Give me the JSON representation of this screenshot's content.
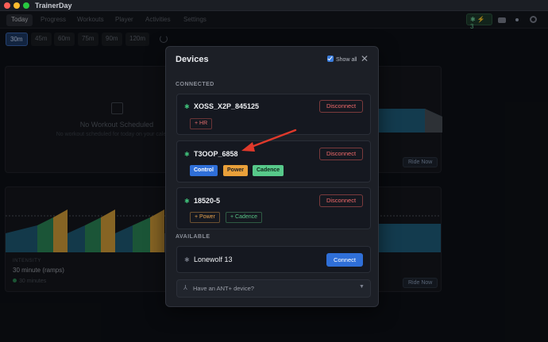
{
  "app": {
    "title": "TrainerDay"
  },
  "nav": {
    "tabs": [
      {
        "label": "Today",
        "active": true
      },
      {
        "label": "Progress"
      },
      {
        "label": "Workouts"
      },
      {
        "label": "Player"
      },
      {
        "label": "Activities"
      },
      {
        "label": "Settings"
      }
    ],
    "bluetooth_chip": "✱ ⚡ 3"
  },
  "durations": [
    {
      "label": "30m",
      "active": true
    },
    {
      "label": "45m"
    },
    {
      "label": "60m"
    },
    {
      "label": "75m"
    },
    {
      "label": "90m"
    },
    {
      "label": "120m"
    }
  ],
  "background": {
    "empty_title": "No Workout Scheduled",
    "empty_sub": "No workout scheduled for today on your calendar",
    "ride_now": "Ride Now",
    "intensity_label": "INTENSITY",
    "workout_name": "30 minute (ramps)",
    "workout_time": "30 minutes"
  },
  "modal": {
    "title": "Devices",
    "show_all": "Show all",
    "connected_label": "CONNECTED",
    "available_label": "AVAILABLE",
    "connected_devices": [
      {
        "name": "XOSS_X2P_845125",
        "action": "Disconnect",
        "features": [
          {
            "label": "+ HR",
            "style": "add-red"
          }
        ]
      },
      {
        "name": "T3OOP_6858",
        "action": "Disconnect",
        "features": [
          {
            "label": "Control",
            "style": "f-blue"
          },
          {
            "label": "Power",
            "style": "f-orange"
          },
          {
            "label": "Cadence",
            "style": "f-green"
          }
        ]
      },
      {
        "name": "18520-5",
        "action": "Disconnect",
        "features": [
          {
            "label": "+ Power",
            "style": "add-orange"
          },
          {
            "label": "+ Cadence",
            "style": "add-green"
          }
        ]
      }
    ],
    "available_devices": [
      {
        "name": "Lonewolf 13",
        "action": "Connect"
      }
    ],
    "ant_prompt": "Have an ANT+ device?"
  },
  "colors": {
    "accent_blue": "#2f6fd8",
    "connected_green": "#3fbf79",
    "disconnect_red": "#f06a6a",
    "annotation_arrow": "#e0392b"
  },
  "icons": {
    "bluetooth": "bluetooth-icon",
    "close": "close-icon",
    "ant": "ant-icon",
    "chevron": "chevron-down-icon"
  }
}
